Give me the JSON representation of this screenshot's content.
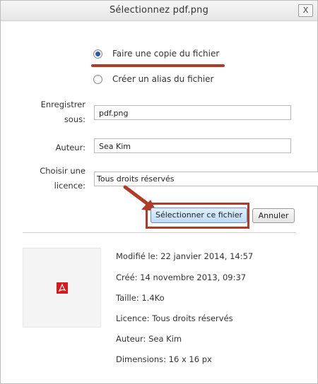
{
  "dialog": {
    "title": "Sélectionnez pdf.png",
    "close_label": "X"
  },
  "options": {
    "copy_label": "Faire une copie du fichier",
    "alias_label": "Créer un alias du fichier",
    "selected": "copy"
  },
  "form": {
    "save_as_label_line1": "Enregistrer",
    "save_as_label_line2": "sous:",
    "save_as_value": "pdf.png",
    "author_label": "Auteur:",
    "author_value": "Sea Kim",
    "license_label_line1": "Choisir une",
    "license_label_line2": "licence:",
    "license_value": "Tous droits réservés"
  },
  "buttons": {
    "select_label": "Sélectionner ce fichier",
    "cancel_label": "Annuler"
  },
  "file_info": {
    "modified": "Modifié le: 22 janvier 2014, 14:57",
    "created": "Créé: 14 novembre 2013, 09:37",
    "size": "Taille: 1.4Ko",
    "license": "Licence: Tous droits réservés",
    "author": "Auteur: Sea Kim",
    "dimensions": "Dimensions: 16 x 16 px"
  },
  "colors": {
    "annotation_red": "#b23a26",
    "radio_selected": "#2d5aa8",
    "pdf_red": "#d51b1b"
  },
  "icons": {
    "thumbnail": "pdf-icon",
    "annotation": "red-arrow-icon"
  }
}
